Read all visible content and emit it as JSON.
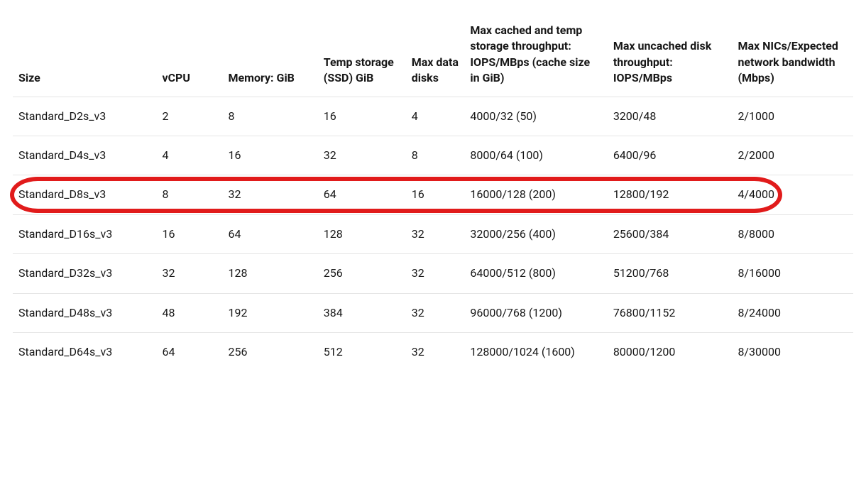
{
  "table": {
    "headers": [
      "Size",
      "vCPU",
      "Memory: GiB",
      "Temp storage (SSD) GiB",
      "Max data disks",
      "Max cached and temp storage throughput: IOPS/MBps (cache size in GiB)",
      "Max uncached disk throughput: IOPS/MBps",
      "Max NICs/Expected network bandwidth (Mbps)"
    ],
    "rows": [
      {
        "size": "Standard_D2s_v3",
        "vcpu": "2",
        "memory": "8",
        "temp": "16",
        "disks": "4",
        "cached": "4000/32 (50)",
        "uncached": "3200/48",
        "nic": "2/1000"
      },
      {
        "size": "Standard_D4s_v3",
        "vcpu": "4",
        "memory": "16",
        "temp": "32",
        "disks": "8",
        "cached": "8000/64 (100)",
        "uncached": "6400/96",
        "nic": "2/2000"
      },
      {
        "size": "Standard_D8s_v3",
        "vcpu": "8",
        "memory": "32",
        "temp": "64",
        "disks": "16",
        "cached": "16000/128 (200)",
        "uncached": "12800/192",
        "nic": "4/4000",
        "highlight": true
      },
      {
        "size": "Standard_D16s_v3",
        "vcpu": "16",
        "memory": "64",
        "temp": "128",
        "disks": "32",
        "cached": "32000/256 (400)",
        "uncached": "25600/384",
        "nic": "8/8000"
      },
      {
        "size": "Standard_D32s_v3",
        "vcpu": "32",
        "memory": "128",
        "temp": "256",
        "disks": "32",
        "cached": "64000/512 (800)",
        "uncached": "51200/768",
        "nic": "8/16000"
      },
      {
        "size": "Standard_D48s_v3",
        "vcpu": "48",
        "memory": "192",
        "temp": "384",
        "disks": "32",
        "cached": "96000/768 (1200)",
        "uncached": "76800/1152",
        "nic": "8/24000"
      },
      {
        "size": "Standard_D64s_v3",
        "vcpu": "64",
        "memory": "256",
        "temp": "512",
        "disks": "32",
        "cached": "128000/1024 (1600)",
        "uncached": "80000/1200",
        "nic": "8/30000"
      }
    ]
  }
}
